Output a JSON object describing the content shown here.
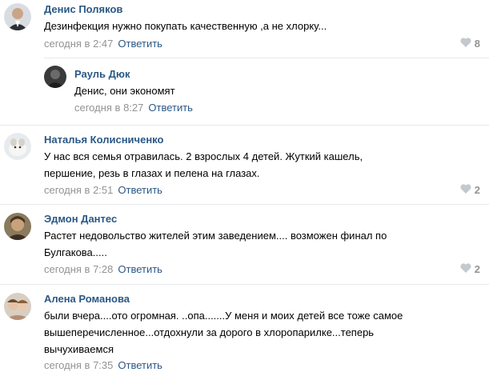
{
  "comments": [
    {
      "author": "Денис Поляков",
      "text": "Дезинфекция нужно покупать качественную ,а не хлорку...",
      "time": "сегодня в 2:47",
      "reply_label": "Ответить",
      "likes": "8"
    },
    {
      "author": "Рауль Дюк",
      "text": "Денис, они экономят",
      "time": "сегодня в 8:27",
      "reply_label": "Ответить"
    },
    {
      "author": "Наталья Колисниченко",
      "text": "У нас вся семья отравилась. 2 взрослых 4 детей. Жуткий кашель,\nпершение, резь в глазах и пелена на глазах.",
      "time": "сегодня в 2:51",
      "reply_label": "Ответить",
      "likes": "2"
    },
    {
      "author": "Эдмон Дантес",
      "text": "Растет недовольство жителей этим заведением.... возможен финал по\nБулгакова.....",
      "time": "сегодня в 7:28",
      "reply_label": "Ответить",
      "likes": "2"
    },
    {
      "author": "Алена Романова",
      "text": "были вчера....ото огромная. ..опа.......У меня и моих детей все тоже самое\nвышеперечисленное...отдохнули за дорого в хлоропарилке...теперь\nвычухиваемся",
      "time": "сегодня в 7:35",
      "reply_label": "Ответить"
    }
  ],
  "colors": {
    "link": "#2a5885",
    "meta": "#939393",
    "divider": "#e7e8ec",
    "like_icon": "#c4c8cf"
  }
}
